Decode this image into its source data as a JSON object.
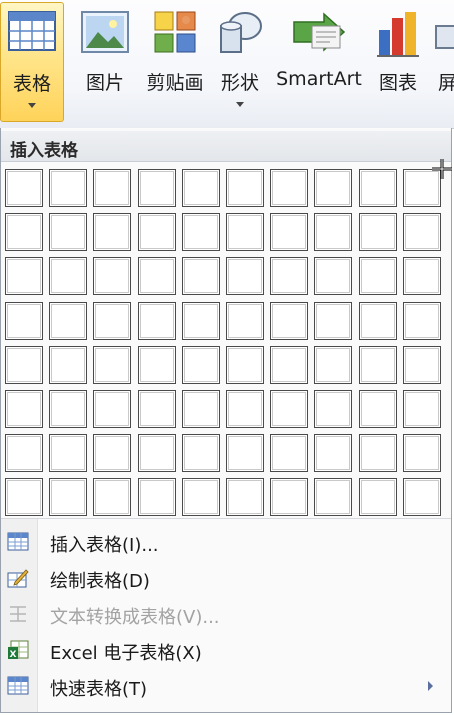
{
  "ribbon": {
    "buttons": [
      {
        "label": "表格",
        "icon": "table-icon",
        "active": true,
        "has_arrow": true
      },
      {
        "label": "图片",
        "icon": "picture-icon"
      },
      {
        "label": "剪贴画",
        "icon": "clipart-icon"
      },
      {
        "label": "形状",
        "icon": "shapes-icon",
        "has_arrow": true
      },
      {
        "label": "SmartArt",
        "icon": "smartart-icon"
      },
      {
        "label": "图表",
        "icon": "chart-icon"
      },
      {
        "label": "屏",
        "icon": "screenshot-icon"
      }
    ]
  },
  "dropdown": {
    "title": "插入表格",
    "grid": {
      "rows": 8,
      "cols": 10
    },
    "menu": [
      {
        "label": "插入表格(I)...",
        "icon": "insert-table-icon",
        "enabled": true
      },
      {
        "label": "绘制表格(D)",
        "icon": "draw-table-icon",
        "enabled": true
      },
      {
        "label": "文本转换成表格(V)...",
        "icon": "text-to-table-icon",
        "enabled": false
      },
      {
        "label": "Excel 电子表格(X)",
        "icon": "excel-spreadsheet-icon",
        "enabled": true
      },
      {
        "label": "快速表格(T)",
        "icon": "quick-tables-icon",
        "enabled": true,
        "submenu": true
      }
    ]
  }
}
